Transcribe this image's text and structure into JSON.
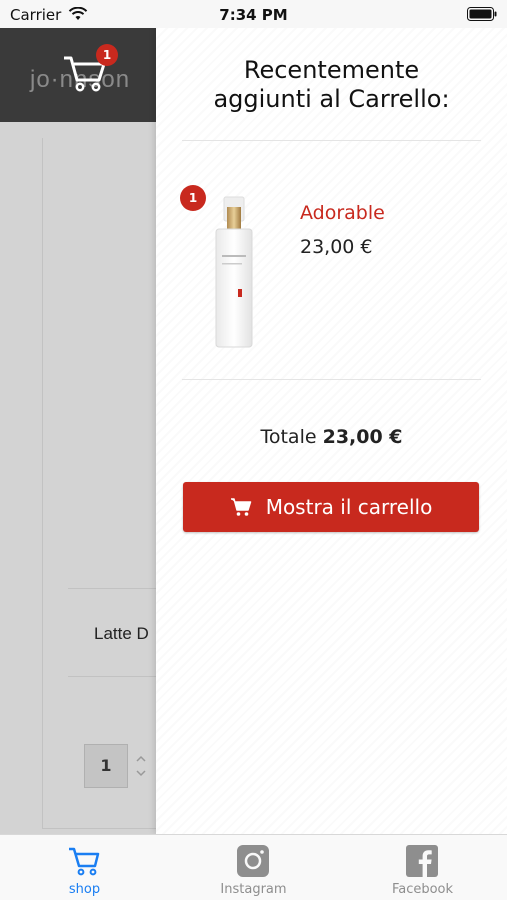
{
  "status_bar": {
    "carrier": "Carrier",
    "time": "7:34 PM"
  },
  "header": {
    "logo_text": "jo·nnson",
    "cart_count": "1"
  },
  "background_page": {
    "product_label": "Latte D",
    "quantity": "1"
  },
  "drawer": {
    "title": "Recentemente\naggiunti al Carrello:",
    "item": {
      "badge": "1",
      "name": "Adorable",
      "price": "23,00 €"
    },
    "total_label": "Totale",
    "total_value": "23,00 €",
    "show_cart_label": "Mostra il carrello"
  },
  "tabbar": {
    "tabs": [
      {
        "label": "shop",
        "icon": "cart-icon",
        "active": true
      },
      {
        "label": "Instagram",
        "icon": "instagram-icon",
        "active": false
      },
      {
        "label": "Facebook",
        "icon": "facebook-icon",
        "active": false
      }
    ]
  },
  "colors": {
    "accent_red": "#c8291e",
    "tab_active": "#1a7ef2",
    "tab_inactive": "#8e8e8e"
  }
}
